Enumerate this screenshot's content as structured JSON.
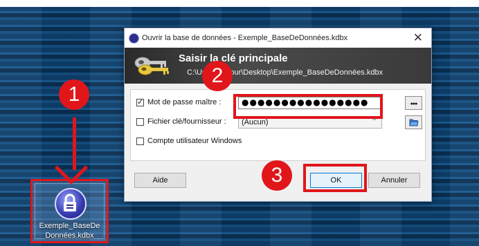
{
  "dialog": {
    "title": "Ouvrir la base de données - Exemple_BaseDeDonnées.kdbx",
    "close": "✕",
    "banner_title": "Saisir la clé principale",
    "banner_path": "C:\\Users\\Amour\\Desktop\\Exemple_BaseDeDonnées.kdbx",
    "password_label": "Mot de passe maître :",
    "password_value": "●●●●●●●●●●●●●●●●",
    "show_password_label": "●●●",
    "keyfile_label": "Fichier clé/fournisseur :",
    "keyfile_value": "(Aucun)",
    "windows_account_label": "Compte utilisateur Windows",
    "help_button": "Aide",
    "ok_button": "OK",
    "cancel_button": "Annuler"
  },
  "desktop": {
    "file_label": "Exemple_BaseDe\nDonnées.kdbx"
  },
  "markers": [
    "1",
    "2",
    "3"
  ],
  "colors": {
    "highlight": "#e0161b",
    "banner": "#3a3a3a"
  }
}
